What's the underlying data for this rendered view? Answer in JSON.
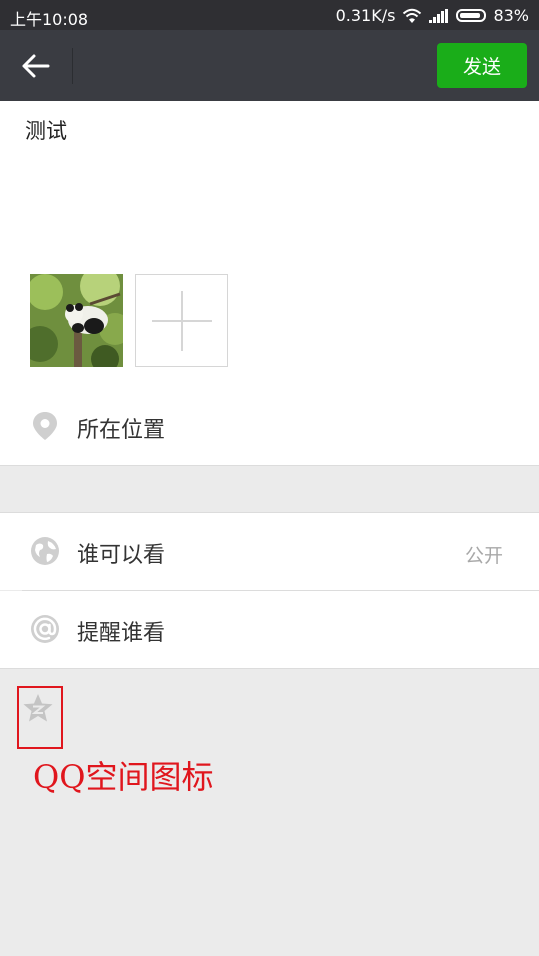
{
  "status_bar": {
    "time": "上午10:08",
    "speed": "0.31K/s",
    "battery": "83%",
    "icons": [
      "wifi-icon",
      "signal-icon",
      "battery-icon"
    ]
  },
  "title_bar": {
    "back_icon": "arrow-left-icon",
    "send_label": "发送",
    "send_color": "#1aad19"
  },
  "compose": {
    "text": "测试",
    "photo": "panda-photo",
    "add_photo_icon": "plus-icon"
  },
  "location": {
    "icon": "location-pin-icon",
    "label": "所在位置"
  },
  "visibility": {
    "icon": "globe-icon",
    "label": "谁可以看",
    "value": "公开"
  },
  "remind": {
    "icon": "at-icon",
    "label": "提醒谁看"
  },
  "qzone": {
    "icon": "qzone-star-icon",
    "annotation": "QQ空间图标",
    "annotation_color": "#e0161d"
  }
}
